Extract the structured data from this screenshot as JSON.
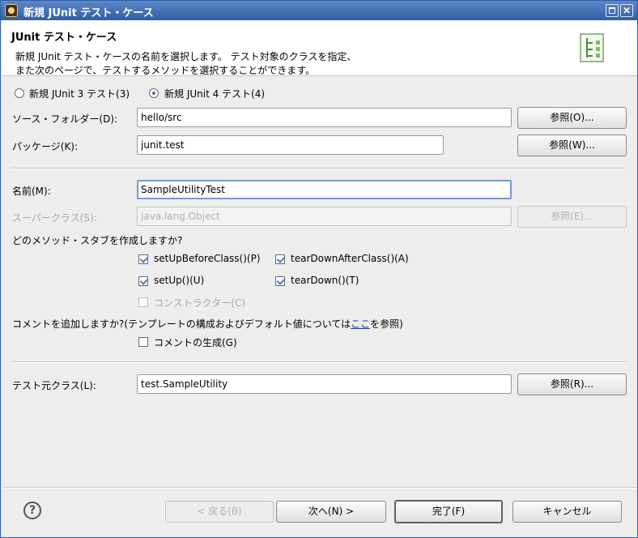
{
  "window": {
    "title": "新規 JUnit テスト・ケース"
  },
  "header": {
    "title": "JUnit テスト・ケース",
    "description_line1": "新規 JUnit テスト・ケースの名前を選択します。 テスト対象のクラスを指定、",
    "description_line2": "また次のページで、テストするメソッドを選択することができます。"
  },
  "version": {
    "junit3_label": "新規 JUnit 3 テスト(3)",
    "junit4_label": "新規 JUnit 4 テスト(4)",
    "selected": "junit4"
  },
  "source_folder": {
    "label": "ソース・フォルダー(D):",
    "value": "hello/src",
    "browse": "参照(O)..."
  },
  "package": {
    "label": "パッケージ(K):",
    "value": "junit.test",
    "browse": "参照(W)..."
  },
  "name": {
    "label": "名前(M):",
    "value": "SampleUtilityTest"
  },
  "superclass": {
    "label": "スーパークラス(S):",
    "value": "java.lang.Object",
    "browse": "参照(E)..."
  },
  "stubs": {
    "question": "どのメソッド・スタブを作成しますか?",
    "setUpBeforeClass": {
      "label": "setUpBeforeClass()(P)",
      "checked": true
    },
    "tearDownAfterClass": {
      "label": "tearDownAfterClass()(A)",
      "checked": true
    },
    "setUp": {
      "label": "setUp()(U)",
      "checked": true
    },
    "tearDown": {
      "label": "tearDown()(T)",
      "checked": true
    },
    "constructor": {
      "label": "コンストラクター(C)",
      "checked": false,
      "enabled": false
    }
  },
  "comments": {
    "question_prefix": "コメントを追加しますか?(テンプレートの構成およびデフォルト値については",
    "question_link": "ここ",
    "question_suffix": "を参照)",
    "generate_label": "コメントの生成(G)",
    "generate_checked": false
  },
  "class_under_test": {
    "label": "テスト元クラス(L):",
    "value": "test.SampleUtility",
    "browse": "参照(R)..."
  },
  "footer": {
    "help": "?",
    "back": "< 戻る(B)",
    "next": "次へ(N) >",
    "finish": "完了(F)",
    "cancel": "キャンセル"
  }
}
